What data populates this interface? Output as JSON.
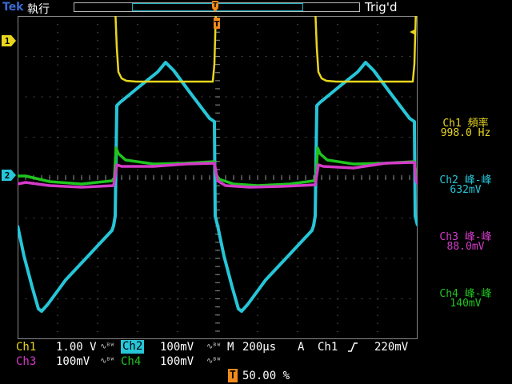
{
  "header": {
    "brand": "Tek",
    "status": "執行",
    "trigger_state": "Trig'd"
  },
  "markers": {
    "ch1": "1",
    "ch2": "2",
    "trigger": "T"
  },
  "measurements": [
    {
      "name": "Ch1 頻率",
      "value": "998.0 Hz",
      "color": "#e8d61e"
    },
    {
      "name": "Ch2 峰-峰",
      "value": "632mV",
      "color": "#26c6d8"
    },
    {
      "name": "Ch3 峰-峰",
      "value": "88.0mV",
      "color": "#d43bc8"
    },
    {
      "name": "Ch4 峰-峰",
      "value": "140mV",
      "color": "#1fc41f"
    }
  ],
  "channels": {
    "ch1": {
      "label": "Ch1",
      "scale": "1.00 V",
      "bw_icon": "∿ᴮᵂ",
      "color": "#e8d61e"
    },
    "ch2": {
      "label": "Ch2",
      "scale": "100mV",
      "bw_icon": "∿ᴮᵂ",
      "color": "#26c6d8"
    },
    "ch3": {
      "label": "Ch3",
      "scale": "100mV",
      "bw_icon": "∿ᴮᵂ",
      "color": "#d43bc8"
    },
    "ch4": {
      "label": "Ch4",
      "scale": "100mV",
      "bw_icon": "∿ᴮᵂ",
      "color": "#1fc41f"
    }
  },
  "timebase": {
    "label": "M",
    "value": "200µs"
  },
  "trigger": {
    "mode": "A",
    "source": "Ch1",
    "slope_icon": "rising-edge-icon",
    "level": "220mV"
  },
  "trigger_position": {
    "icon": "T",
    "value": "50.00 %"
  },
  "colors": {
    "ch1": "#e8d61e",
    "ch2": "#26c6d8",
    "ch3": "#d43bc8",
    "ch4": "#1fc41f",
    "trigger": "#f08a1c",
    "grid": "#888888"
  }
}
